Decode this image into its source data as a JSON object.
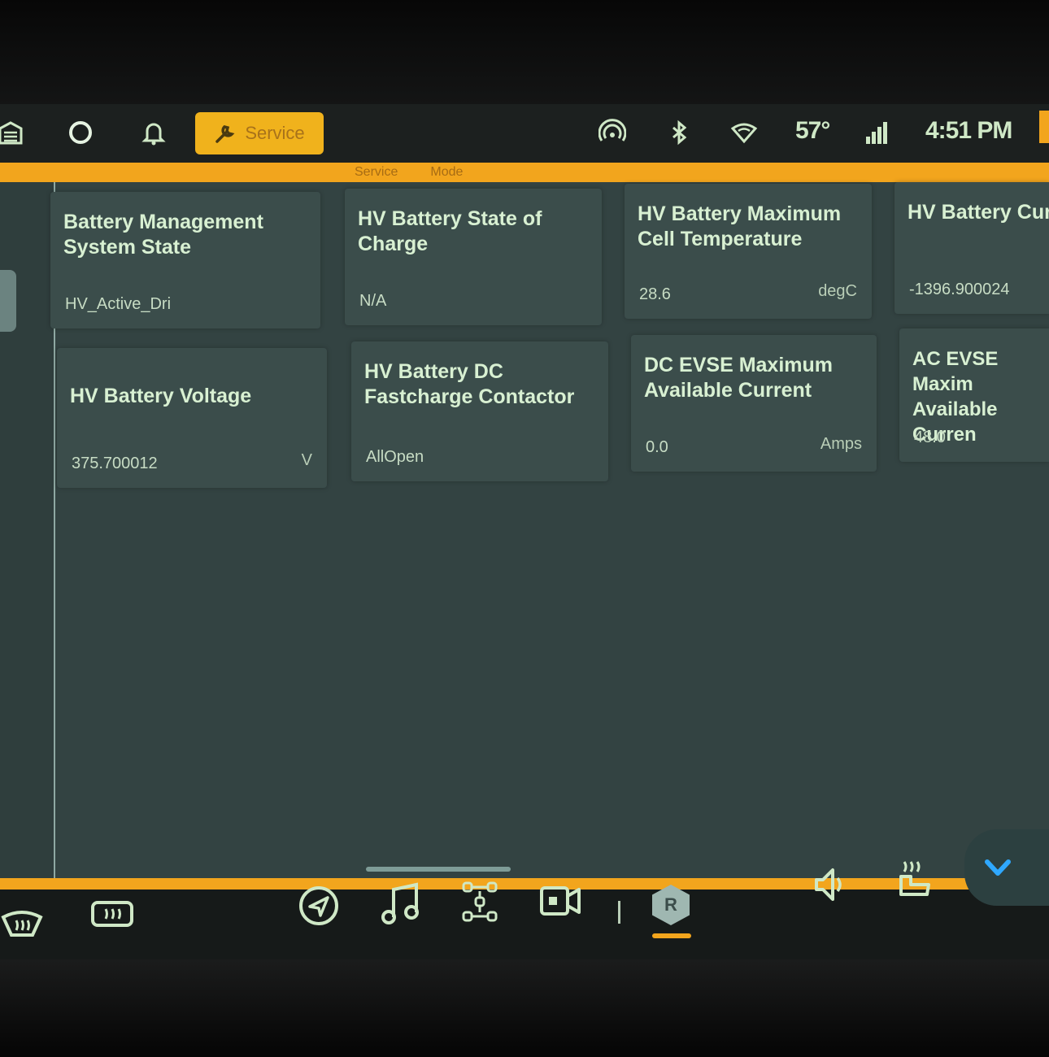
{
  "status_bar": {
    "service_label": "Service",
    "temperature": "57°",
    "time": "4:51 PM"
  },
  "mode_band": {
    "word1": "Service",
    "word2": "Mode"
  },
  "cards": [
    {
      "title": "Battery Management System State",
      "value": "HV_Active_Dri",
      "unit": ""
    },
    {
      "title": "HV Battery State of Charge",
      "value": "N/A",
      "unit": ""
    },
    {
      "title": "HV Battery Maximum Cell Temperature",
      "value": "28.6",
      "unit": "degC"
    },
    {
      "title": "HV Battery Curre",
      "value": "-1396.900024",
      "unit": ""
    },
    {
      "title": "HV Battery Voltage",
      "value": "375.700012",
      "unit": "V"
    },
    {
      "title": "HV Battery DC Fastcharge Contactor",
      "value": "AllOpen",
      "unit": ""
    },
    {
      "title": "DC EVSE Maximum Available Current",
      "value": "0.0",
      "unit": "Amps"
    },
    {
      "title": "AC EVSE Maxim Available Curren",
      "value": "48.0",
      "unit": ""
    }
  ],
  "bottom_bar": {
    "gear": "R"
  },
  "colors": {
    "accent": "#f2a51d",
    "card_bg": "#3b4d4b",
    "content_bg": "#334342",
    "text": "#d8f0d2"
  }
}
